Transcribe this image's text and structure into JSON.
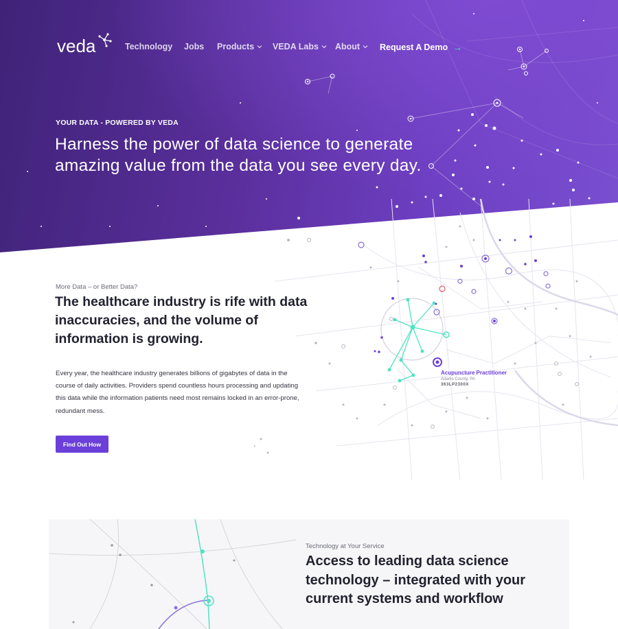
{
  "brand": {
    "logo_text": "veda"
  },
  "nav": {
    "items": [
      {
        "label": "Technology",
        "has_dropdown": false
      },
      {
        "label": "Jobs",
        "has_dropdown": false
      },
      {
        "label": "Products",
        "has_dropdown": true
      },
      {
        "label": "VEDA Labs",
        "has_dropdown": true
      },
      {
        "label": "About",
        "has_dropdown": true
      }
    ],
    "cta_label": "Request A Demo",
    "cta_arrow": "→"
  },
  "hero": {
    "eyebrow": "YOUR DATA - POWERED BY VEDA",
    "headline": "Harness the power of data science to generate amazing value from the data you see every day."
  },
  "section_data": {
    "kicker": "More Data – or Better Data?",
    "title": "The healthcare industry is rife with data inaccuracies, and the volume of information is growing.",
    "body": "Every year, the healthcare industry generates billions of gigabytes of data in the course of daily activities. Providers spend countless hours processing and updating this data while the information patients need most remains locked in an error-prone, redundant mess.",
    "button_label": "Find Out How"
  },
  "map_label": {
    "title": "Acupuncture Practitioner",
    "location": "Adams County, PA",
    "code": "363LP2300X"
  },
  "section_tech": {
    "kicker": "Technology at Your Service",
    "title": "Access to leading data science technology – integrated with your current systems and workflow"
  },
  "colors": {
    "accent_purple": "#6b3fd9",
    "accent_teal": "#4fe3c1",
    "hero_dark": "#3f2378",
    "hero_light": "#7a4fd0"
  }
}
